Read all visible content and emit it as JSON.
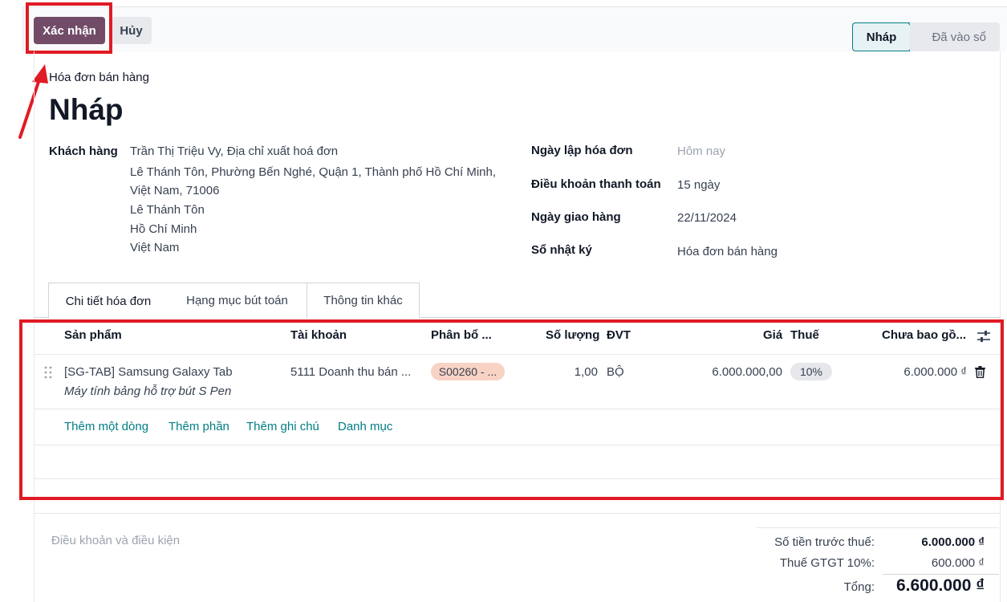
{
  "toolbar": {
    "confirm_label": "Xác nhận",
    "cancel_label": "Hủy"
  },
  "statusbar": {
    "current": "Nháp",
    "next": "Đã vào sổ"
  },
  "header": {
    "move_type": "Hóa đơn bán hàng",
    "title": "Nháp"
  },
  "customer": {
    "label": "Khách hàng",
    "name": "Trần Thị Triệu Vy, Địa chỉ xuất hoá đơn",
    "address_lines": [
      "Lê Thánh Tôn, Phường Bến Nghé, Quận 1, Thành phố Hồ Chí Minh,",
      "Việt Nam, 71006",
      "Lê Thánh Tôn",
      "Hồ Chí Minh",
      "Việt Nam"
    ]
  },
  "fields": {
    "invoice_date_label": "Ngày lập hóa đơn",
    "invoice_date_placeholder": "Hôm nay",
    "payment_terms_label": "Điều khoản thanh toán",
    "payment_terms_value": "15 ngày",
    "delivery_date_label": "Ngày giao hàng",
    "delivery_date_value": "22/11/2024",
    "journal_label": "Sổ nhật ký",
    "journal_value": "Hóa đơn bán hàng"
  },
  "tabs": [
    "Chi tiết hóa đơn",
    "Hạng mục bút toán",
    "Thông tin khác"
  ],
  "table": {
    "headers": {
      "product": "Sản phẩm",
      "account": "Tài khoản",
      "analytic": "Phân bổ ...",
      "quantity": "Số lượng",
      "uom": "ĐVT",
      "price": "Giá",
      "tax": "Thuế",
      "subtotal": "Chưa bao gồ..."
    },
    "rows": [
      {
        "product": "[SG-TAB] Samsung Galaxy Tab",
        "description": "Máy tính bảng hỗ trợ bút S Pen",
        "account": "5111 Doanh thu bán ...",
        "analytic": "S00260 - ...",
        "quantity": "1,00",
        "uom": "BỘ",
        "price": "6.000.000,00",
        "tax": "10%",
        "subtotal": "6.000.000 ₫"
      }
    ],
    "actions": [
      "Thêm một dòng",
      "Thêm phần",
      "Thêm ghi chú",
      "Danh mục"
    ]
  },
  "footer": {
    "terms_placeholder": "Điều khoản và điều kiện",
    "untaxed_label": "Số tiền trước thuế:",
    "untaxed_value": "6.000.000 ₫",
    "tax_label": "Thuế GTGT 10%:",
    "tax_value": "600.000 ₫",
    "total_label": "Tổng:",
    "total_value": "6.600.000 ₫"
  },
  "colors": {
    "primary": "#714b67",
    "accent": "#017e84",
    "highlight": "#e01b24",
    "analytic_pill": "#f8d2c4",
    "tax_pill": "#e5e7eb"
  }
}
